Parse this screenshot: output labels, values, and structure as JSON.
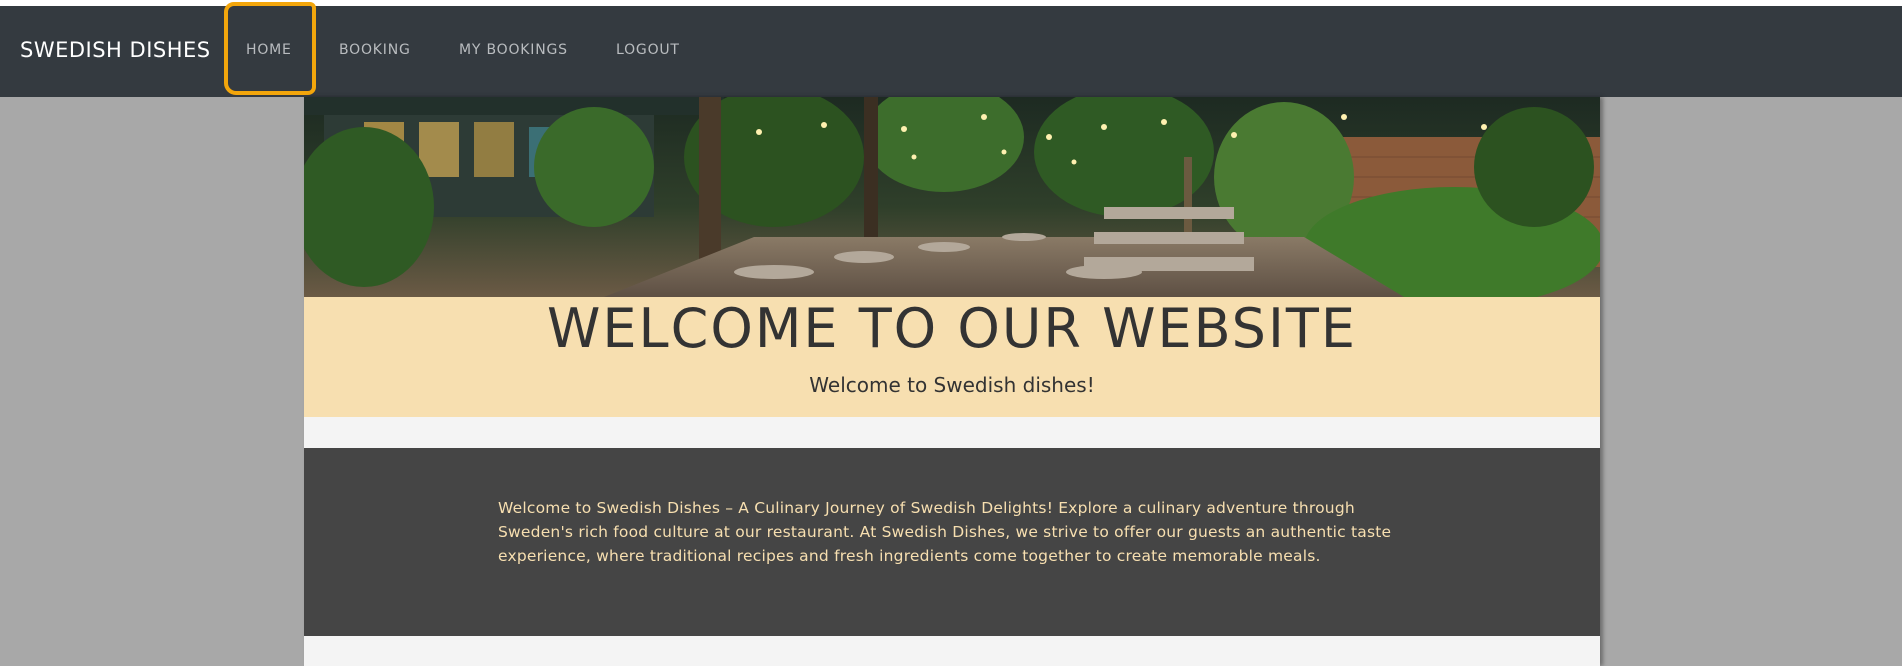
{
  "navbar": {
    "brand": "SWEDISH DISHES",
    "links": [
      {
        "label": "HOME",
        "active": true
      },
      {
        "label": "BOOKING"
      },
      {
        "label": "MY BOOKINGS"
      },
      {
        "label": "LOGOUT"
      }
    ],
    "background": "#343a40",
    "highlight_color": "#f3a60c"
  },
  "hero": {
    "image": "restaurant-garden-photo"
  },
  "welcome": {
    "title": "WELCOME TO OUR WEBSITE",
    "subtitle": "Welcome to Swedish dishes!",
    "background": "#f7dfb0"
  },
  "about": {
    "text": "Welcome to Swedish Dishes – A Culinary Journey of Swedish Delights! Explore a culinary adventure through Sweden's rich food culture at our restaurant. At Swedish Dishes, we strive to offer our guests an authentic taste experience, where traditional recipes and fresh ingredients come together to create memorable meals.",
    "background": "#454545",
    "text_color": "#f7dfb0"
  }
}
